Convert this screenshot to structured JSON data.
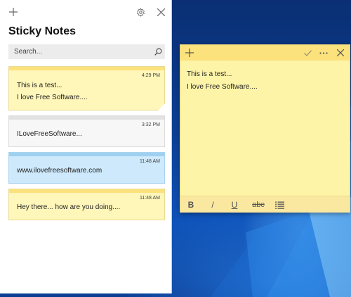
{
  "colors": {
    "yellow_note": "#fff6b9",
    "yellow_stripe": "#fbe27d",
    "white_note": "#f7f7f7",
    "white_stripe": "#e2e2e2",
    "blue_note": "#cde9fb",
    "blue_stripe": "#9fd0f0"
  },
  "list_window": {
    "title": "Sticky Notes",
    "add_icon": "plus-icon",
    "settings_icon": "gear-icon",
    "close_icon": "close-icon",
    "search": {
      "placeholder": "Search...",
      "value": "",
      "icon": "search-icon"
    },
    "notes": [
      {
        "time": "4:29 PM",
        "line1": "This is a test...",
        "line2": "I love Free Software....",
        "color": "yellow"
      },
      {
        "time": "3:32 PM",
        "line1": "ILoveFreeSoftware...",
        "line2": "",
        "color": "white"
      },
      {
        "time": "11:48 AM",
        "line1": "www.ilovefreesoftware.com",
        "line2": "",
        "color": "blue"
      },
      {
        "time": "11:48 AM",
        "line1": "Hey there... how are you doing....",
        "line2": "",
        "color": "yellow"
      }
    ]
  },
  "note_window": {
    "text_line1": "This is a test...",
    "text_line2": "I love Free Software....",
    "header_icons": [
      "plus-icon",
      "checkmark-icon",
      "more-icon",
      "close-icon"
    ],
    "format": {
      "bold": "B",
      "italic": "/",
      "underline": "U",
      "strikethrough": "abc",
      "list_icon": "bullet-list-icon"
    }
  }
}
